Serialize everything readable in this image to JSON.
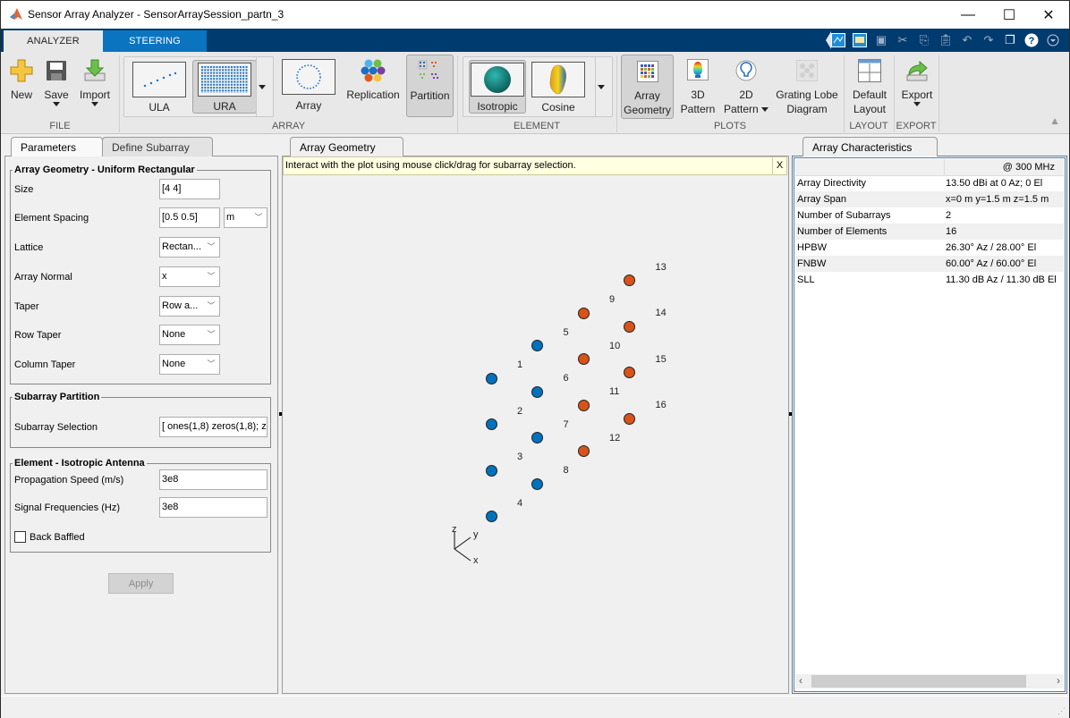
{
  "window": {
    "title": "Sensor Array Analyzer - SensorArraySession_partn_3",
    "controls": {
      "minimize": "—",
      "maximize": "☐",
      "close": "✕"
    }
  },
  "ribbon_tabs": [
    {
      "label": "ANALYZER",
      "active": true
    },
    {
      "label": "STEERING",
      "active": false
    }
  ],
  "quick_access": [
    {
      "icon": "plot-icon"
    },
    {
      "icon": "figure-icon"
    },
    {
      "icon": "save-icon"
    },
    {
      "icon": "cut-icon"
    },
    {
      "icon": "copy-icon"
    },
    {
      "icon": "paste-icon"
    },
    {
      "icon": "undo-icon"
    },
    {
      "icon": "redo-icon"
    },
    {
      "icon": "window-icon"
    },
    {
      "icon": "help-icon"
    },
    {
      "icon": "menu-icon"
    }
  ],
  "ribbon": {
    "file": {
      "group": "FILE",
      "new": "New",
      "save": "Save",
      "import": "Import"
    },
    "array": {
      "group": "ARRAY",
      "ula": "ULA",
      "ura": "URA",
      "array": "Array",
      "replication": "Replication",
      "partition": "Partition"
    },
    "element": {
      "group": "ELEMENT",
      "isotropic": "Isotropic",
      "cosine": "Cosine"
    },
    "plots": {
      "group": "PLOTS",
      "array_geometry_1": "Array",
      "array_geometry_2": "Geometry",
      "pattern3d_1": "3D",
      "pattern3d_2": "Pattern",
      "pattern2d_1": "2D",
      "pattern2d_2": "Pattern",
      "grating_1": "Grating Lobe",
      "grating_2": "Diagram"
    },
    "layout": {
      "group": "LAYOUT",
      "default_1": "Default",
      "default_2": "Layout"
    },
    "export": {
      "group": "EXPORT",
      "export": "Export"
    }
  },
  "left_panel": {
    "tabs": [
      {
        "label": "Parameters",
        "active": true
      },
      {
        "label": "Define Subarray",
        "active": false
      }
    ],
    "array_geometry": {
      "title": "Array Geometry - Uniform Rectangular",
      "size_label": "Size",
      "size_value": "[4 4]",
      "spacing_label": "Element Spacing",
      "spacing_value": "[0.5 0.5]",
      "spacing_unit": "m",
      "lattice_label": "Lattice",
      "lattice_value": "Rectan...",
      "normal_label": "Array Normal",
      "normal_value": "x",
      "taper_label": "Taper",
      "taper_value": "Row a...",
      "row_taper_label": "Row Taper",
      "row_taper_value": "None",
      "col_taper_label": "Column Taper",
      "col_taper_value": "None"
    },
    "subarray": {
      "title": "Subarray Partition",
      "selection_label": "Subarray Selection",
      "selection_value": "[ ones(1,8) zeros(1,8); z"
    },
    "element": {
      "title": "Element - Isotropic Antenna",
      "speed_label": "Propagation Speed (m/s)",
      "speed_value": "3e8",
      "freq_label": "Signal Frequencies (Hz)",
      "freq_value": "3e8",
      "baffled_label": "Back Baffled",
      "baffled_checked": false
    },
    "apply": "Apply"
  },
  "center_panel": {
    "tab": "Array Geometry",
    "info": "Interact with the plot using mouse click/drag for subarray selection.",
    "info_close": "X",
    "subarray_colors": {
      "1": "#0072bd",
      "2": "#d95319"
    },
    "elements": [
      {
        "n": "1",
        "subarray": 1
      },
      {
        "n": "2",
        "subarray": 1
      },
      {
        "n": "3",
        "subarray": 1
      },
      {
        "n": "4",
        "subarray": 1
      },
      {
        "n": "5",
        "subarray": 1
      },
      {
        "n": "6",
        "subarray": 1
      },
      {
        "n": "7",
        "subarray": 1
      },
      {
        "n": "8",
        "subarray": 1
      },
      {
        "n": "9",
        "subarray": 2
      },
      {
        "n": "10",
        "subarray": 2
      },
      {
        "n": "11",
        "subarray": 2
      },
      {
        "n": "12",
        "subarray": 2
      },
      {
        "n": "13",
        "subarray": 2
      },
      {
        "n": "14",
        "subarray": 2
      },
      {
        "n": "15",
        "subarray": 2
      },
      {
        "n": "16",
        "subarray": 2
      }
    ],
    "axes": {
      "x": "x",
      "y": "y",
      "z": "z"
    }
  },
  "right_panel": {
    "tab": "Array Characteristics",
    "column_header": "@ 300 MHz",
    "rows": [
      {
        "label": "Array Directivity",
        "value": "13.50 dBi at 0 Az; 0 El"
      },
      {
        "label": "Array Span",
        "value": "x=0 m y=1.5 m z=1.5 m"
      },
      {
        "label": "Number of Subarrays",
        "value": "2"
      },
      {
        "label": "Number of Elements",
        "value": "16"
      },
      {
        "label": "HPBW",
        "value": "26.30° Az / 28.00° El"
      },
      {
        "label": "FNBW",
        "value": "60.00° Az / 60.00° El"
      },
      {
        "label": "SLL",
        "value": "11.30 dB Az / 11.30 dB El"
      }
    ]
  }
}
